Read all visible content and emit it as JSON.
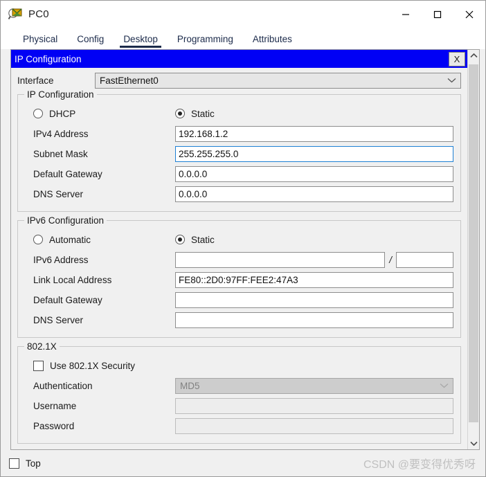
{
  "window": {
    "title": "PC0",
    "icon": "packet-tracer-device-icon",
    "controls": {
      "minimize": "—",
      "maximize": "□",
      "close": "✕"
    }
  },
  "tabs": [
    {
      "label": "Physical",
      "active": false
    },
    {
      "label": "Config",
      "active": false
    },
    {
      "label": "Desktop",
      "active": true
    },
    {
      "label": "Programming",
      "active": false
    },
    {
      "label": "Attributes",
      "active": false
    }
  ],
  "dialog": {
    "title": "IP Configuration",
    "close_label": "X",
    "title_bg": "#0000f5",
    "title_fg": "#ffffff"
  },
  "interface": {
    "label": "Interface",
    "value": "FastEthernet0",
    "chevron": "⌄"
  },
  "ipv4": {
    "group_label": "IP Configuration",
    "mode": {
      "dhcp_label": "DHCP",
      "static_label": "Static",
      "selected": "Static"
    },
    "fields": [
      {
        "label": "IPv4 Address",
        "value": "192.168.1.2",
        "focused": false,
        "disabled": false
      },
      {
        "label": "Subnet Mask",
        "value": "255.255.255.0",
        "focused": true,
        "disabled": false
      },
      {
        "label": "Default Gateway",
        "value": "0.0.0.0",
        "focused": false,
        "disabled": false
      },
      {
        "label": "DNS Server",
        "value": "0.0.0.0",
        "focused": false,
        "disabled": false
      }
    ]
  },
  "ipv6": {
    "group_label": "IPv6 Configuration",
    "mode": {
      "automatic_label": "Automatic",
      "static_label": "Static",
      "selected": "Static"
    },
    "address": {
      "label": "IPv6 Address",
      "value": "",
      "separator": "/",
      "prefix_value": ""
    },
    "fields": [
      {
        "label": "Link Local Address",
        "value": "FE80::2D0:97FF:FEE2:47A3"
      },
      {
        "label": "Default Gateway",
        "value": ""
      },
      {
        "label": "DNS Server",
        "value": ""
      }
    ]
  },
  "dot1x": {
    "group_label": "802.1X",
    "checkbox_label": "Use 802.1X Security",
    "checked": false,
    "authentication": {
      "label": "Authentication",
      "value": "MD5",
      "disabled": true
    },
    "username": {
      "label": "Username",
      "value": "",
      "disabled": true
    },
    "password": {
      "label": "Password",
      "value": "",
      "disabled": true
    }
  },
  "footer": {
    "top_checkbox_label": "Top",
    "top_checked": false,
    "watermark": "CSDN @要变得优秀呀"
  },
  "scrollbar": {
    "up_arrow": "ⱏ",
    "down_arrow": "ⱛ"
  }
}
